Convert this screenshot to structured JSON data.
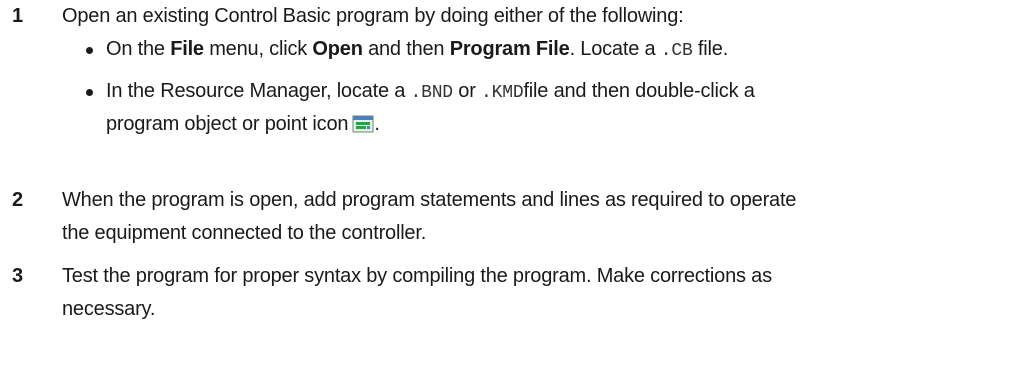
{
  "steps": [
    {
      "number": "1",
      "text": "Open an existing Control Basic program by doing either of the following:",
      "bullets": [
        {
          "pre": "On the ",
          "menu": "File",
          "mid1": " menu, click ",
          "cmd1": "Open",
          "mid2": " and then ",
          "cmd2": "Program File",
          "mid3": ". Locate a ",
          "ext": ".CB",
          "post": " file."
        },
        {
          "pre": "In the Resource Manager, locate a ",
          "ext1": ".BND",
          "mid": " or ",
          "ext2": ".KMD",
          "post": "file and then double-click a",
          "line2": "program object or point icon",
          "end": ".",
          "icon": "program-point-icon"
        }
      ]
    },
    {
      "number": "2",
      "line1": "When the program is open, add program statements and lines as required to operate",
      "line2": "the equipment connected to the controller."
    },
    {
      "number": "3",
      "line1": "Test the program for proper syntax by compiling the program. Make corrections as",
      "line2": "necessary."
    }
  ],
  "colors": {
    "text": "#1a1a1a",
    "icon_green": "#2e9e3e",
    "icon_blue": "#4a7fc1"
  }
}
